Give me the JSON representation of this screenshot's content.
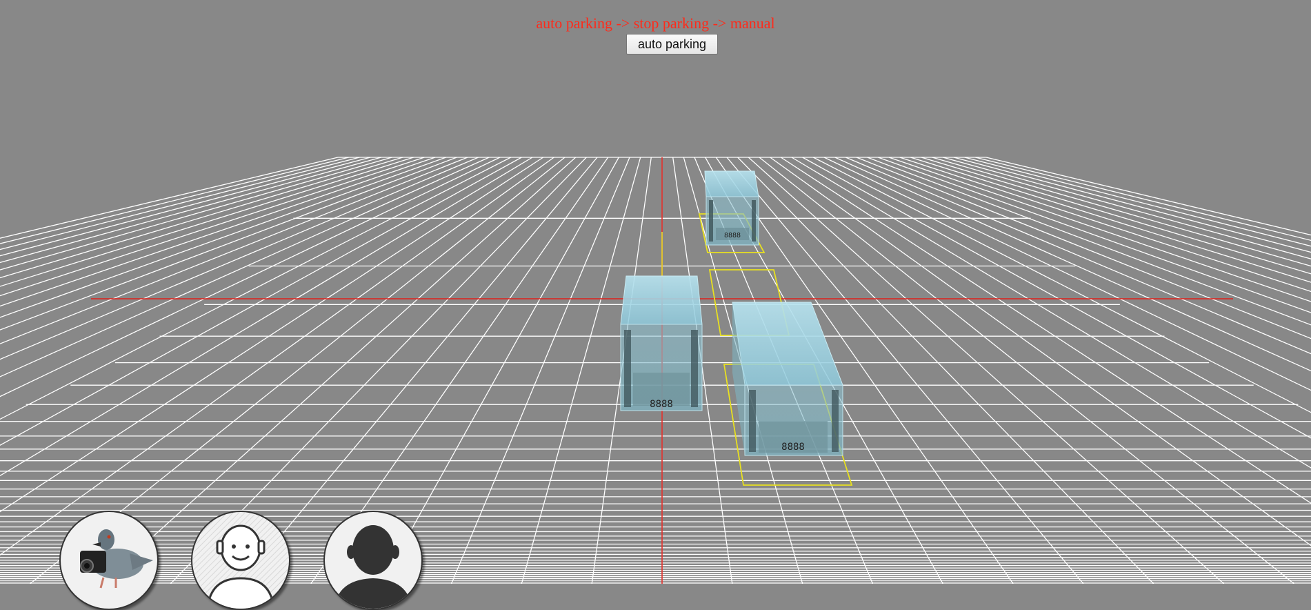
{
  "status": {
    "text": "auto parking -> stop parking -> manual",
    "color": "#ff2a1a"
  },
  "controls": {
    "mode_button_label": "auto parking"
  },
  "scene": {
    "background": "#888888",
    "grid_color": "#ffffff",
    "axis_color": "#e0201a",
    "parking_outline_color": "#e8e020",
    "vehicle_color": "#9fd6e6",
    "plate_text": "8888"
  },
  "avatars": [
    {
      "name": "pigeon-camera-avatar",
      "icon": "pigeon-with-camera"
    },
    {
      "name": "smiling-face-avatar",
      "icon": "smiling-person-outline"
    },
    {
      "name": "silhouette-avatar",
      "icon": "person-silhouette"
    }
  ]
}
